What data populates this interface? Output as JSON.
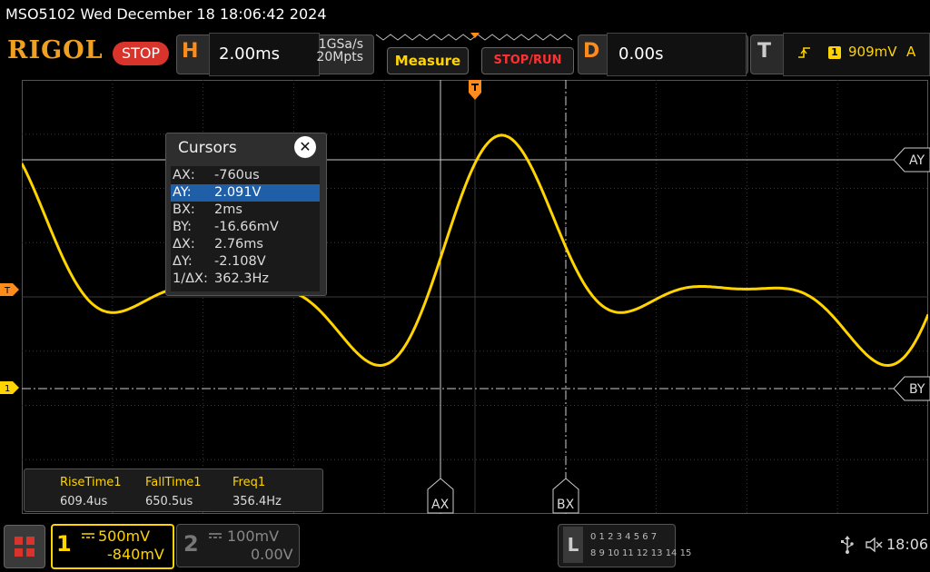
{
  "status_line": "MSO5102  Wed December 18 18:06:42 2024",
  "brand": "RIGOL",
  "run_state": "STOP",
  "horizontal": {
    "key": "H",
    "timebase": "2.00ms",
    "sample_rate": "1GSa/s",
    "memory_depth": "20Mpts"
  },
  "buttons": {
    "measure": "Measure",
    "stop_run": "STOP/RUN"
  },
  "delay": {
    "key": "D",
    "value": "0.00s"
  },
  "trigger": {
    "key": "T",
    "source": "1",
    "level": "909mV",
    "mode": "A"
  },
  "colors": {
    "ch1": "#ffd400",
    "accent": "#ff8c1a",
    "stop": "#d9342b",
    "highlight": "#1f5fa8"
  },
  "cursors": {
    "title": "Cursors",
    "rows": [
      {
        "label": "AX:",
        "value": "-760us"
      },
      {
        "label": "AY:",
        "value": "2.091V"
      },
      {
        "label": "BX:",
        "value": "2ms"
      },
      {
        "label": "BY:",
        "value": "-16.66mV"
      },
      {
        "label": "ΔX:",
        "value": "2.76ms"
      },
      {
        "label": "ΔY:",
        "value": "-2.108V"
      },
      {
        "label": "1/ΔX:",
        "value": "362.3Hz"
      }
    ],
    "selected_row": "AY:",
    "markers": {
      "ax": "AX",
      "bx": "BX",
      "ay": "AY",
      "by": "BY"
    }
  },
  "measurements": [
    {
      "label": "RiseTime1",
      "value": "609.4us"
    },
    {
      "label": "FallTime1",
      "value": "650.5us"
    },
    {
      "label": "Freq1",
      "value": "356.4Hz"
    }
  ],
  "left_markers": {
    "trigger": "T",
    "ch1": "1"
  },
  "channels": [
    {
      "number": "1",
      "scale": "500mV",
      "offset": "-840mV",
      "active": true
    },
    {
      "number": "2",
      "scale": "100mV",
      "offset": "0.00V",
      "active": false
    }
  ],
  "logic_analyzer": {
    "key": "L",
    "row1": "0 1 2 3   4 5 6 7",
    "row2": "8 9 10 11  12 13 14 15"
  },
  "system": {
    "clock": "18:06",
    "icons": [
      "usb-icon",
      "speaker-muted-icon",
      "menu-grid-icon"
    ]
  }
}
